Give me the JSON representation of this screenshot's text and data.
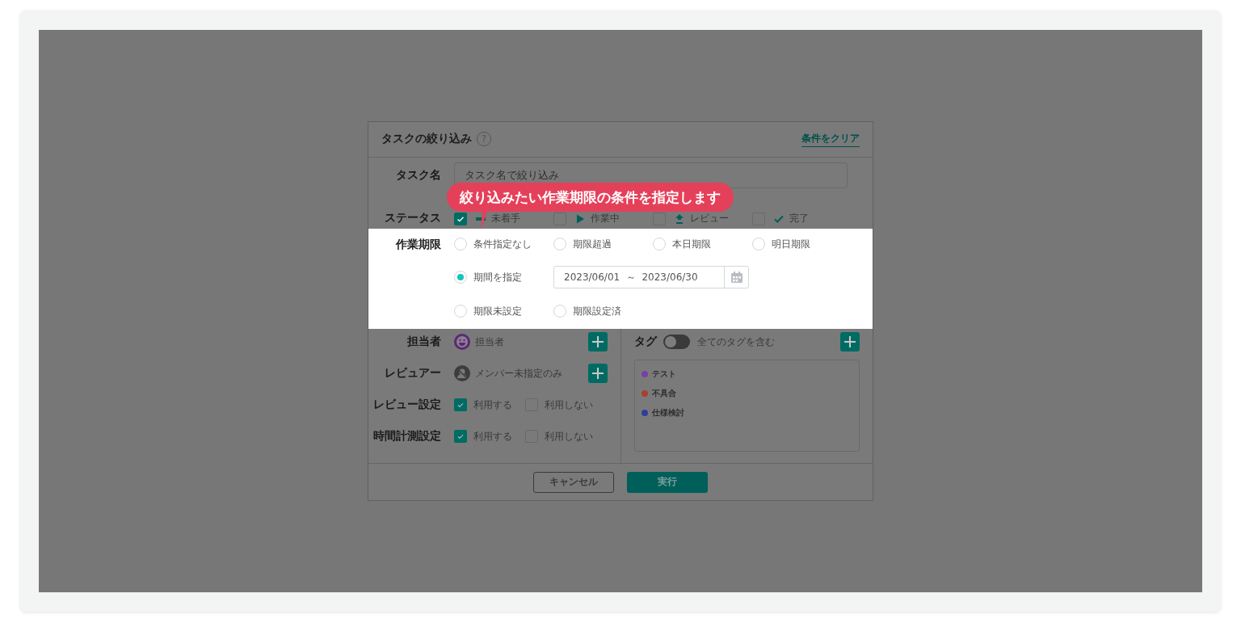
{
  "callout": {
    "text": "絞り込みたい作業期限の条件を指定します"
  },
  "dialog": {
    "title": "タスクの絞り込み",
    "help_icon": "?",
    "clear_link": "条件をクリア",
    "task_name": {
      "label": "タスク名",
      "placeholder": "タスク名で絞り込み"
    },
    "status": {
      "label": "ステータス",
      "options": [
        {
          "label": "未着手",
          "kind": "not-started",
          "checked": true
        },
        {
          "label": "作業中",
          "kind": "in-progress",
          "checked": false
        },
        {
          "label": "レビュー",
          "kind": "review",
          "checked": false
        },
        {
          "label": "完了",
          "kind": "done",
          "checked": false
        }
      ]
    },
    "due": {
      "label": "作業期限",
      "highlighted": true,
      "rows": [
        {
          "options": [
            {
              "label": "条件指定なし",
              "selected": false
            },
            {
              "label": "期限超過",
              "selected": false
            },
            {
              "label": "本日期限",
              "selected": false
            },
            {
              "label": "明日期限",
              "selected": false
            }
          ]
        },
        {
          "options": [
            {
              "label": "期間を指定",
              "selected": true
            }
          ],
          "date_range": "2023/06/01  ～  2023/06/30"
        },
        {
          "options": [
            {
              "label": "期限未設定",
              "selected": false
            },
            {
              "label": "期限設定済",
              "selected": false
            }
          ]
        }
      ]
    },
    "people": [
      {
        "label": "担当者",
        "kind": "assignee",
        "value": "担当者"
      },
      {
        "label": "レビュアー",
        "kind": "unassigned",
        "value": "メンバー未指定のみ"
      }
    ],
    "settings": [
      {
        "label": "レビュー設定",
        "options": [
          {
            "label": "利用する",
            "checked": true
          },
          {
            "label": "利用しない",
            "checked": false
          }
        ]
      },
      {
        "label": "時間計測設定",
        "options": [
          {
            "label": "利用する",
            "checked": true
          },
          {
            "label": "利用しない",
            "checked": false
          }
        ]
      }
    ],
    "tags": {
      "label": "タグ",
      "match_all": {
        "label": "全てのタグを含む",
        "on": false
      },
      "items": [
        {
          "label": "テスト",
          "color": "#7b3fa8"
        },
        {
          "label": "不具合",
          "color": "#a5412c"
        },
        {
          "label": "仕様検討",
          "color": "#2f3e9a"
        }
      ]
    },
    "buttons": {
      "cancel": "キャンセル",
      "run": "実行"
    }
  }
}
